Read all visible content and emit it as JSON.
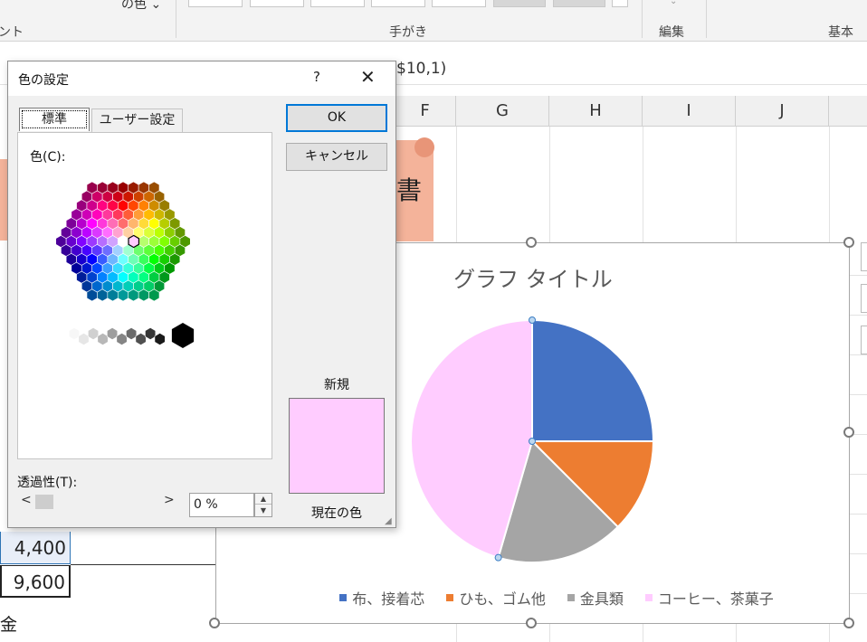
{
  "ribbon": {
    "color_button": "の色 ⌄",
    "font_group_label": "ント",
    "pen_group_label": "手がき",
    "edit_group_label": "編集",
    "basic_group_label": "基本"
  },
  "formula_bar": {
    "text": "$10,1)"
  },
  "columns": [
    "F",
    "G",
    "H",
    "I",
    "J"
  ],
  "sheet": {
    "banner_text": "書",
    "cell_values": [
      "4,400",
      "9,600"
    ],
    "left_label": "金"
  },
  "dialog": {
    "title": "色の設定",
    "help_label": "?",
    "close_label": "✕",
    "tabs": [
      {
        "label": "標準",
        "selected": true
      },
      {
        "label": "ユーザー設定",
        "selected": false
      }
    ],
    "color_label": "色(C):",
    "transparency_label": "透過性(T):",
    "transparency_value": "0 %",
    "ok_label": "OK",
    "cancel_label": "キャンセル",
    "new_label": "新規",
    "current_label": "現在の色",
    "selected_color": "#ffccff"
  },
  "chart_data": {
    "type": "pie",
    "title": "グラフ タイトル",
    "categories": [
      "布、接着芯",
      "ひも、ゴム他",
      "金具類",
      "コーヒー、茶菓子"
    ],
    "values": [
      25,
      12.5,
      17,
      45.5
    ],
    "colors": [
      "#4472c4",
      "#ed7d31",
      "#a5a5a5",
      "#ffccff"
    ],
    "legend_position": "bottom"
  }
}
